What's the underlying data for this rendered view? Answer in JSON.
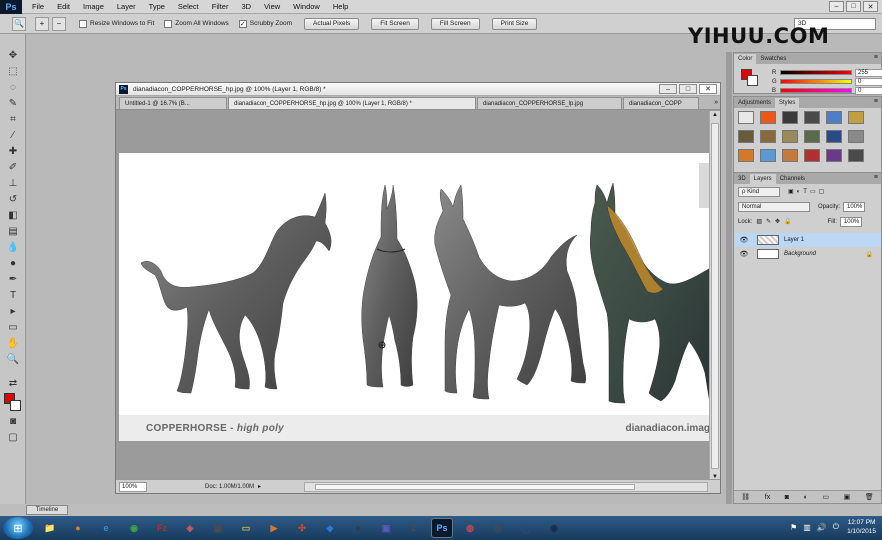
{
  "app": {
    "logo": "Ps"
  },
  "menu": [
    "File",
    "Edit",
    "Image",
    "Layer",
    "Type",
    "Select",
    "Filter",
    "3D",
    "View",
    "Window",
    "Help"
  ],
  "window_controls": [
    "–",
    "□",
    "✕"
  ],
  "options": {
    "checkboxes": [
      {
        "label": "Resize Windows to Fit",
        "checked": ""
      },
      {
        "label": "Zoom All Windows",
        "checked": ""
      },
      {
        "label": "Scrubby Zoom",
        "checked": "✓"
      }
    ],
    "buttons": [
      "Actual Pixels",
      "Fit Screen",
      "Fill Screen",
      "Print Size"
    ],
    "workspace": "3D"
  },
  "watermark": "YIHUU.COM",
  "document": {
    "title": "dianadiacon_COPPERHORSE_hp.jpg @ 100% (Layer 1, RGB/8) *",
    "tabs": [
      "Untitled-1 @ 16.7% (B...",
      "dianadiacon_COPPERHORSE_hp.jpg @ 100% (Layer 1, RGB/8) *",
      "dianadiacon_COPPERHORSE_lp.jpg",
      "dianadiacon_COPP"
    ],
    "caption_left": "COPPERHORSE -",
    "caption_left_italic": "high poly",
    "caption_right": "dianadiacon.imag",
    "zoom": "100%",
    "doc_info": "Doc: 1.00M/1.00M"
  },
  "panels": {
    "color_tabs": [
      "Color",
      "Swatches"
    ],
    "color": {
      "r": "255",
      "g": "0",
      "b": "0",
      "r_label": "R",
      "g_label": "G",
      "b_label": "B"
    },
    "styles_tabs": [
      "Adjustments",
      "Styles"
    ],
    "styles_swatches": [
      "#e8e8e8",
      "#e85a1c",
      "#3a3a3a",
      "#4a4a4a",
      "#4e7fc4",
      "#c0a040",
      "#6a5a3c",
      "#8a6a3a",
      "#9a8a5a",
      "#5a6a4a",
      "#2a4a8a",
      "#8a8a8a",
      "#d27a2a",
      "#5a9ad2",
      "#c47a3a",
      "#b03030",
      "#6a3a8a",
      "#4a4a4a"
    ],
    "layers_tabs": [
      "3D",
      "Layers",
      "Channels"
    ],
    "layers_kind": "Kind",
    "blend_mode": "Normal",
    "opacity_label": "Opacity:",
    "opacity": "100%",
    "lock_label": "Lock:",
    "fill_label": "Fill:",
    "fill": "100%",
    "layers": [
      {
        "name": "Layer 1",
        "selected": true
      },
      {
        "name": "Background",
        "selected": false
      }
    ]
  },
  "timeline_label": "Timeline",
  "tray": {
    "time": "12:07 PM",
    "date": "1/10/2015"
  },
  "taskbar_apps": [
    {
      "name": "explorer",
      "glyph": "📁",
      "color": "#d8a84a"
    },
    {
      "name": "firefox",
      "glyph": "●",
      "color": "#e8781e"
    },
    {
      "name": "ie",
      "glyph": "e",
      "color": "#3a8ad8"
    },
    {
      "name": "chrome",
      "glyph": "◉",
      "color": "#3aa84a"
    },
    {
      "name": "filezilla",
      "glyph": "Fz",
      "color": "#c02828"
    },
    {
      "name": "app6",
      "glyph": "◈",
      "color": "#c85a5a"
    },
    {
      "name": "app7",
      "glyph": "▦",
      "color": "#4a4a4a"
    },
    {
      "name": "app8",
      "glyph": "▭",
      "color": "#c8b45a"
    },
    {
      "name": "app9",
      "glyph": "▶",
      "color": "#d8782a"
    },
    {
      "name": "app10",
      "glyph": "✣",
      "color": "#d84a2a"
    },
    {
      "name": "dropbox",
      "glyph": "◆",
      "color": "#2a7ad8"
    },
    {
      "name": "app12",
      "glyph": "●",
      "color": "#3a3a3a"
    },
    {
      "name": "app13",
      "glyph": "▣",
      "color": "#5a5ab8"
    },
    {
      "name": "zbrush",
      "glyph": "Z",
      "color": "#4a4a4a"
    },
    {
      "name": "photoshop",
      "glyph": "Ps",
      "color": "#0a1a2e"
    },
    {
      "name": "app16",
      "glyph": "◍",
      "color": "#c84a4a"
    },
    {
      "name": "app17",
      "glyph": "◎",
      "color": "#4a4a4a"
    },
    {
      "name": "app18",
      "glyph": "◯",
      "color": "#2a4a7a"
    },
    {
      "name": "app19",
      "glyph": "◉",
      "color": "#1a2a4a"
    }
  ]
}
